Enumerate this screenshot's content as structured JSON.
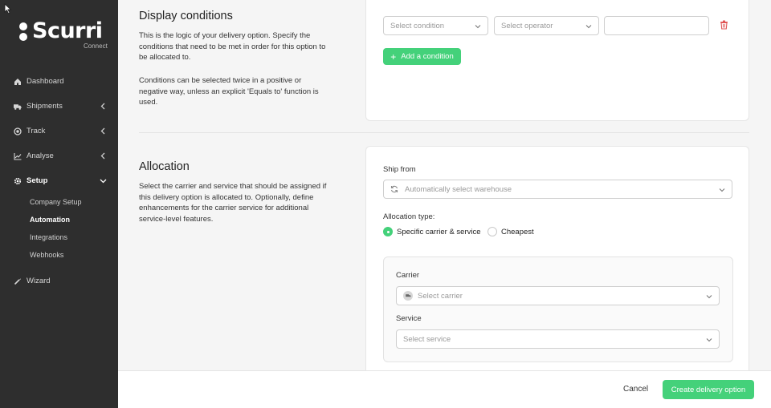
{
  "brand": {
    "name": "Scurri",
    "sub": "Connect"
  },
  "sidebar": {
    "items": [
      {
        "label": "Dashboard",
        "icon": "home-icon"
      },
      {
        "label": "Shipments",
        "icon": "truck-icon"
      },
      {
        "label": "Track",
        "icon": "target-icon"
      },
      {
        "label": "Analyse",
        "icon": "chart-icon"
      },
      {
        "label": "Setup",
        "icon": "gear-icon"
      },
      {
        "label": "Wizard",
        "icon": "wand-icon"
      }
    ],
    "setup_sub": [
      "Company Setup",
      "Automation",
      "Integrations",
      "Webhooks"
    ]
  },
  "display_conditions": {
    "title": "Display conditions",
    "description1": "This is the logic of your delivery option. Specify the conditions that need to be met in order for this option to be allocated to.",
    "description2": "Conditions can be selected twice in a positive or negative way, unless an explicit 'Equals to' function is used.",
    "condition_placeholder": "Select condition",
    "operator_placeholder": "Select operator",
    "value": "",
    "add_label": "Add a condition"
  },
  "allocation": {
    "title": "Allocation",
    "description": "Select the carrier and service that should be assigned if this delivery option is allocated to. Optionally, define enhancements for the carrier service for additional service-level features.",
    "ship_from_label": "Ship from",
    "ship_from_value": "Automatically select warehouse",
    "type_label": "Allocation type:",
    "type_options": [
      "Specific carrier & service",
      "Cheapest"
    ],
    "selected_type": "Specific carrier & service",
    "carrier_label": "Carrier",
    "carrier_placeholder": "Select carrier",
    "service_label": "Service",
    "service_placeholder": "Select service"
  },
  "footer": {
    "cancel": "Cancel",
    "create": "Create delivery option"
  },
  "colors": {
    "accent": "#44d17a",
    "sidebar": "#2e2e2e",
    "danger": "#e05555"
  }
}
